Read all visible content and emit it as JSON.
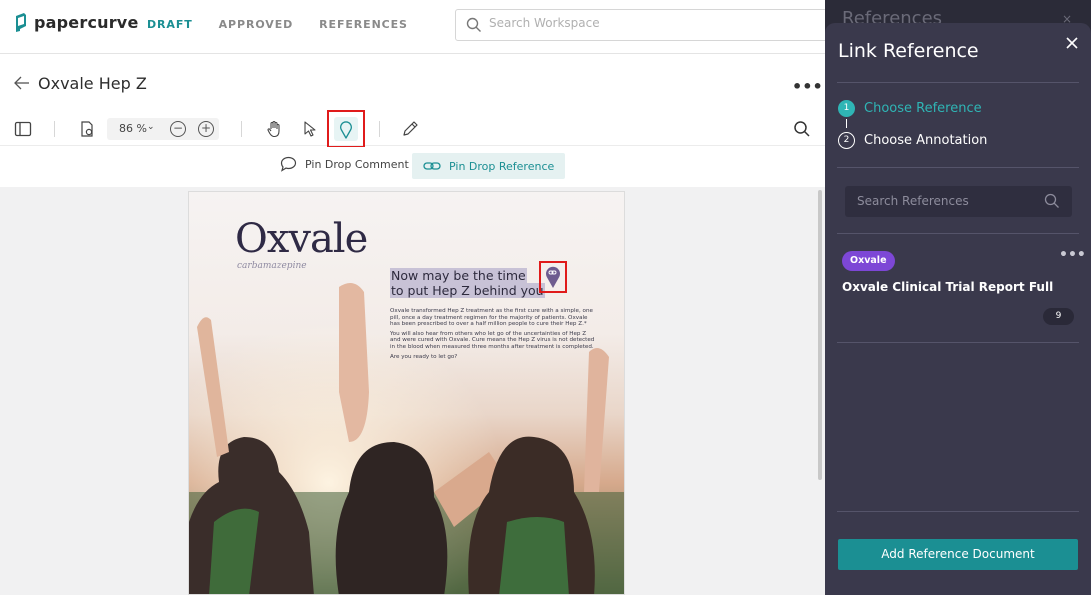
{
  "app": {
    "logo_text": "papercurve",
    "nav": [
      {
        "label": "DRAFT",
        "active": true
      },
      {
        "label": "APPROVED",
        "active": false
      },
      {
        "label": "REFERENCES",
        "active": false
      }
    ],
    "search_placeholder": "Search Workspace"
  },
  "document": {
    "title": "Oxvale Hep Z",
    "more": "•••"
  },
  "toolbar": {
    "zoom": "86 %",
    "zoom_chevron": "⌄",
    "zoom_out": "−",
    "zoom_in": "+",
    "active_tool": "pin-drop-reference"
  },
  "subbar": {
    "pin_comment_label": "Pin Drop Comment",
    "pin_reference_label": "Pin Drop Reference"
  },
  "page_content": {
    "brand": "Oxvale",
    "brand_sub": "carbamazepine",
    "headline_line1": "Now may be the time",
    "headline_line2": "to put Hep Z behind you",
    "para1": "Oxvale transformed Hep Z treatment as the first cure with a simple, one pill, once a day treatment regimen for the majority of patients. Oxvale has been prescribed to over a half million people to cure their Hep Z.*",
    "para2": "You will also hear from others who let go of the uncertainties of Hep Z and were cured with Oxvale. Cure means the Hep Z virus is not detected in the blood when measured three months after treatment is completed.",
    "para3": "Are you ready to let go?"
  },
  "panel_under": {
    "title": "References",
    "close": "×"
  },
  "panel": {
    "title": "Link Reference",
    "steps": [
      {
        "number": "1",
        "label": "Choose Reference",
        "active": true
      },
      {
        "number": "2",
        "label": "Choose Annotation",
        "active": false
      }
    ],
    "search_placeholder": "Search References",
    "reference": {
      "tag": "Oxvale",
      "more": "•••",
      "title": "Oxvale Clinical Trial Report Full",
      "count": "9"
    },
    "add_button": "Add Reference Document"
  },
  "colors": {
    "accent": "#1b8f93",
    "panel_bg": "#3a394c",
    "tag": "#7d47d6",
    "highlight_box": "#e01b1b"
  }
}
